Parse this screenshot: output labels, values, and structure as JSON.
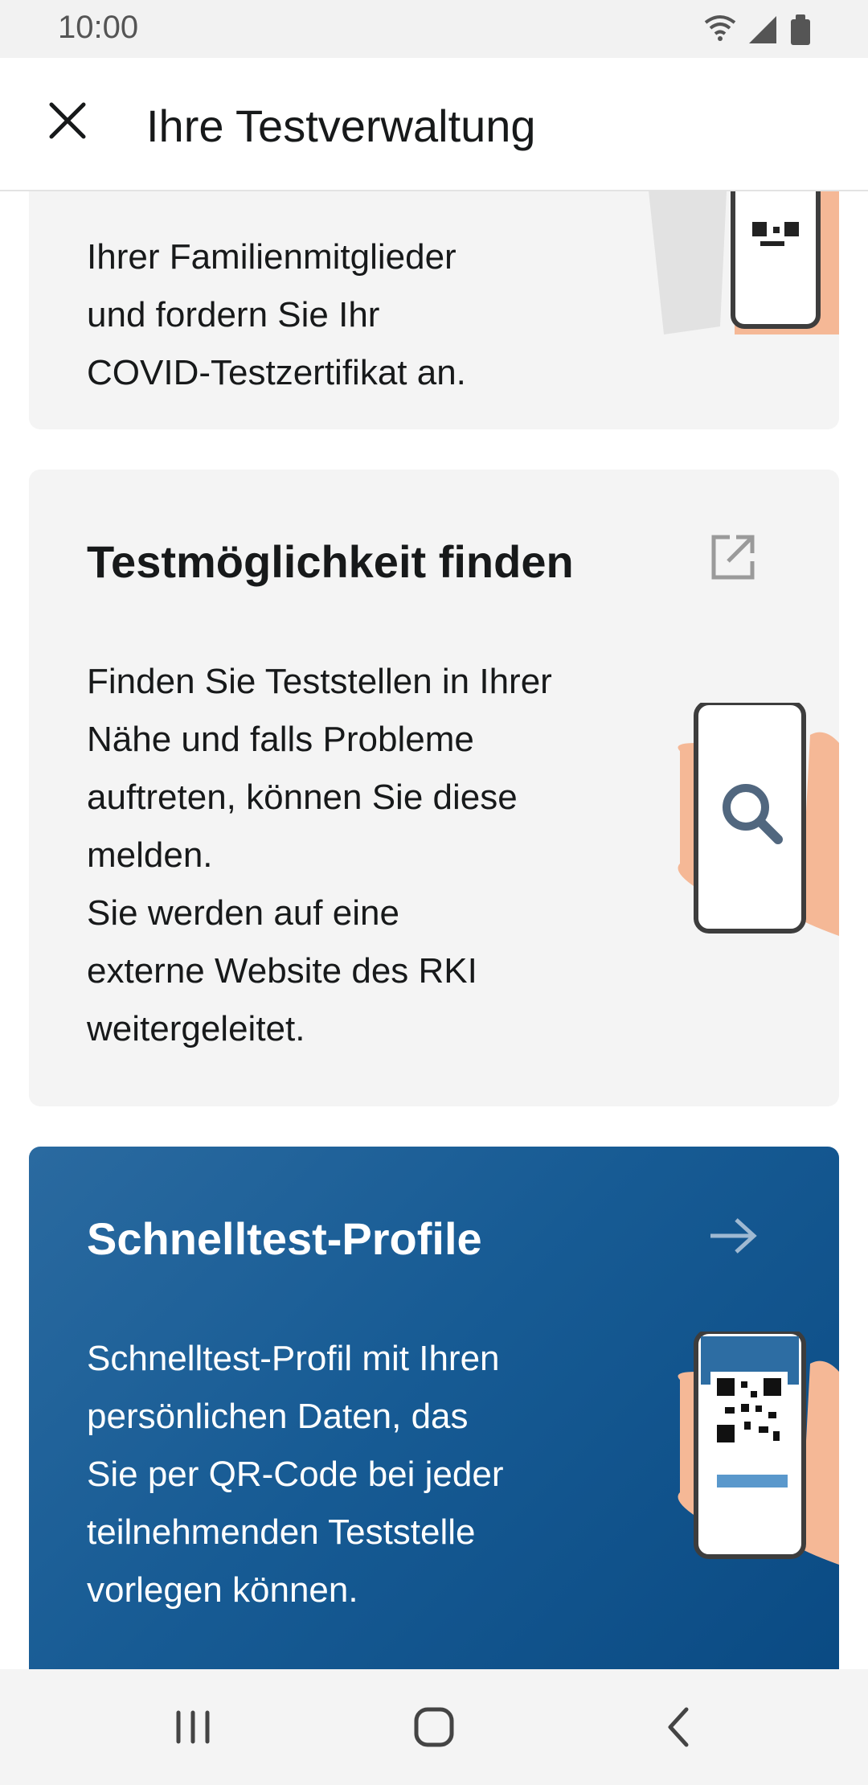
{
  "status_bar": {
    "time": "10:00"
  },
  "app_bar": {
    "title": "Ihre Testverwaltung"
  },
  "card_certificate": {
    "body_lines": [
      "Ihrer Familienmitglieder",
      "und fordern Sie Ihr",
      "COVID-Testzertifikat an."
    ]
  },
  "card_test_finder": {
    "title": "Testmöglichkeit finden",
    "body_lines": [
      "Finden Sie Teststellen in Ihrer",
      "Nähe und falls Probleme",
      "auftreten, können Sie diese",
      "melden.",
      "Sie werden auf eine",
      "externe Website des RKI",
      "weitergeleitet."
    ]
  },
  "card_rapid_profiles": {
    "title": "Schnelltest-Profile",
    "body_lines": [
      "Schnelltest-Profil mit Ihren",
      "persönlichen Daten, das",
      "Sie per QR-Code bei jeder",
      "teilnehmenden Teststelle",
      "vorlegen können."
    ]
  },
  "colors": {
    "blue_card_start": "#2a6aa0",
    "blue_card_end": "#0a4a83",
    "gray_card": "#f4f4f4",
    "skin": "#f5b896",
    "phone_outline": "#3d3d3d"
  },
  "icons": {
    "close": "close-icon",
    "external_link": "external-link-icon",
    "arrow": "arrow-right-icon",
    "search": "magnifier-icon"
  }
}
